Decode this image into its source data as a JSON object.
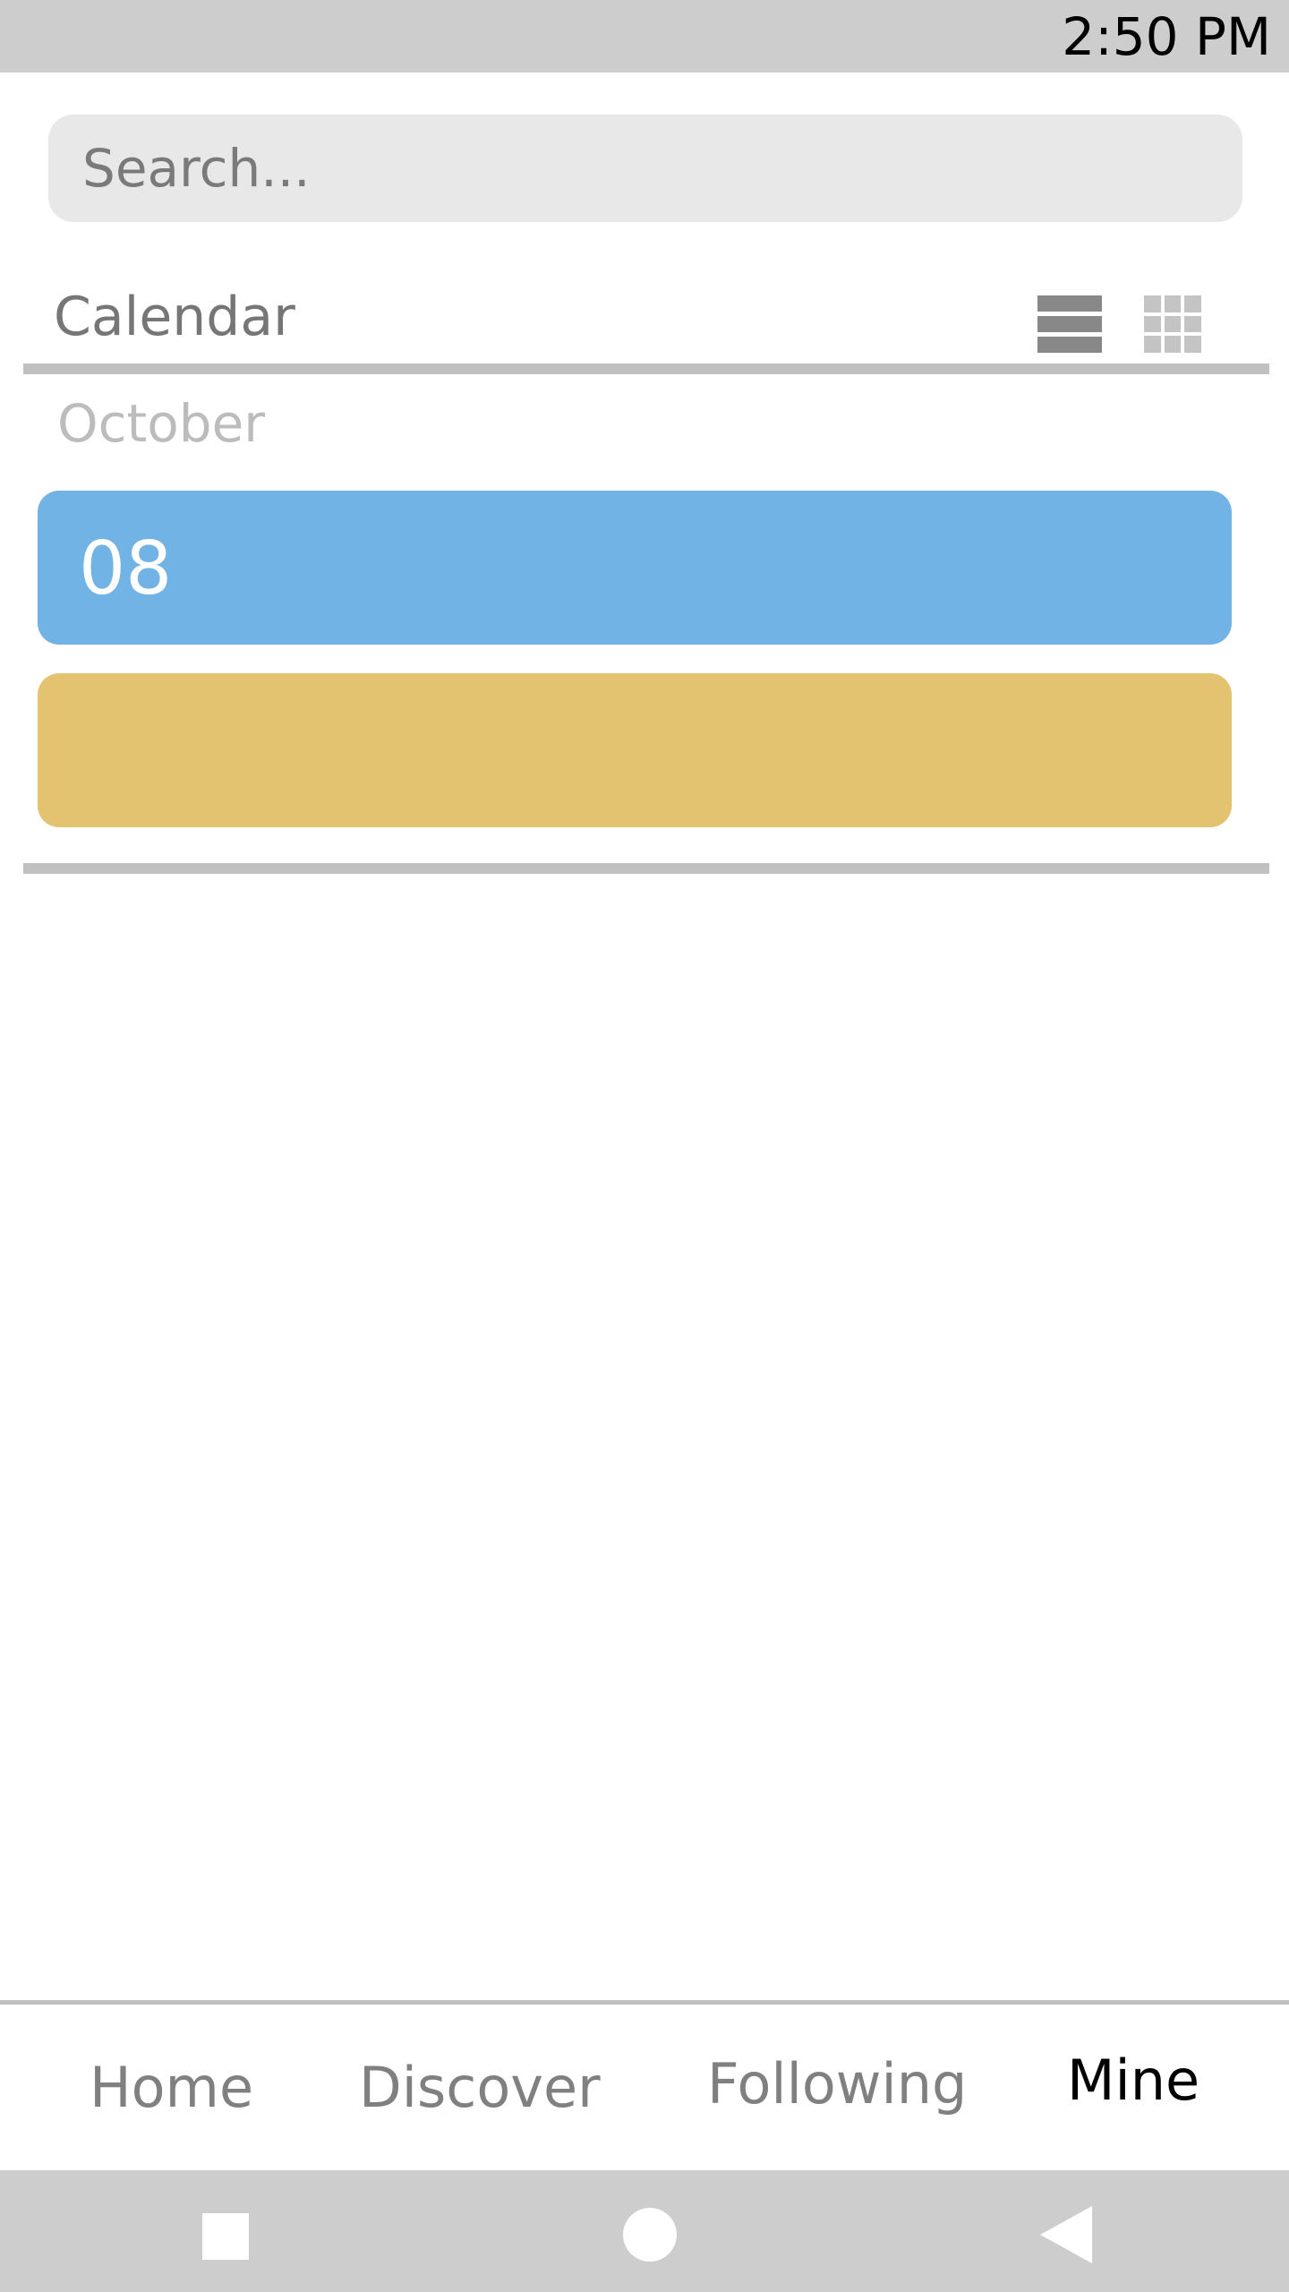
{
  "status_bar": {
    "time": "2:50 PM"
  },
  "search": {
    "placeholder": "Search..."
  },
  "calendar": {
    "title": "Calendar",
    "month": "October",
    "events": [
      {
        "day": "08",
        "color": "#72b3e5"
      },
      {
        "day": "",
        "color": "#e3c270"
      }
    ]
  },
  "tabs": {
    "home": "Home",
    "discover": "Discover",
    "following": "Following",
    "mine": "Mine",
    "active": "Mine"
  },
  "icons": {
    "list_view": "list-view-icon",
    "grid_view": "grid-view-icon",
    "nav_recent": "square-icon",
    "nav_home": "circle-icon",
    "nav_back": "triangle-back-icon"
  },
  "colors": {
    "status_bar": "#cdcdcd",
    "search_bg": "#e8e8e8",
    "divider": "#c0c0c0",
    "active_tab": "#000000",
    "inactive_tab": "#808080"
  }
}
